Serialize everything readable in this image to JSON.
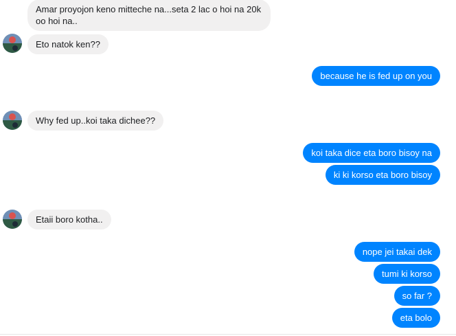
{
  "conversation": {
    "messages": [
      {
        "sender": "them",
        "text": "Amar proyojon keno mitteche na...seta 2 lac o hoi na 20k oo hoi na.."
      },
      {
        "sender": "them",
        "text": "Eto natok ken??"
      },
      {
        "sender": "me",
        "text": "because he is fed up on you"
      },
      {
        "sender": "them",
        "text": "Why fed up..koi taka dichee??"
      },
      {
        "sender": "me",
        "text": "koi taka dice eta boro bisoy na"
      },
      {
        "sender": "me",
        "text": "ki ki korso eta boro bisoy"
      },
      {
        "sender": "them",
        "text": "Etaii boro kotha.."
      },
      {
        "sender": "me",
        "text": "nope jei takai dek"
      },
      {
        "sender": "me",
        "text": "tumi ki korso"
      },
      {
        "sender": "me",
        "text": "so far ?"
      },
      {
        "sender": "me",
        "text": "eta bolo"
      }
    ]
  },
  "avatar": {
    "icon": "profile-photo",
    "colors": {
      "sky": "#6f8fb6",
      "ground": "#2f5a44",
      "accent": "#d9534f"
    }
  },
  "colors": {
    "outgoing_bubble": "#0084ff",
    "incoming_bubble": "#f1f0f0",
    "incoming_text": "#1c1e21",
    "outgoing_text": "#ffffff"
  }
}
